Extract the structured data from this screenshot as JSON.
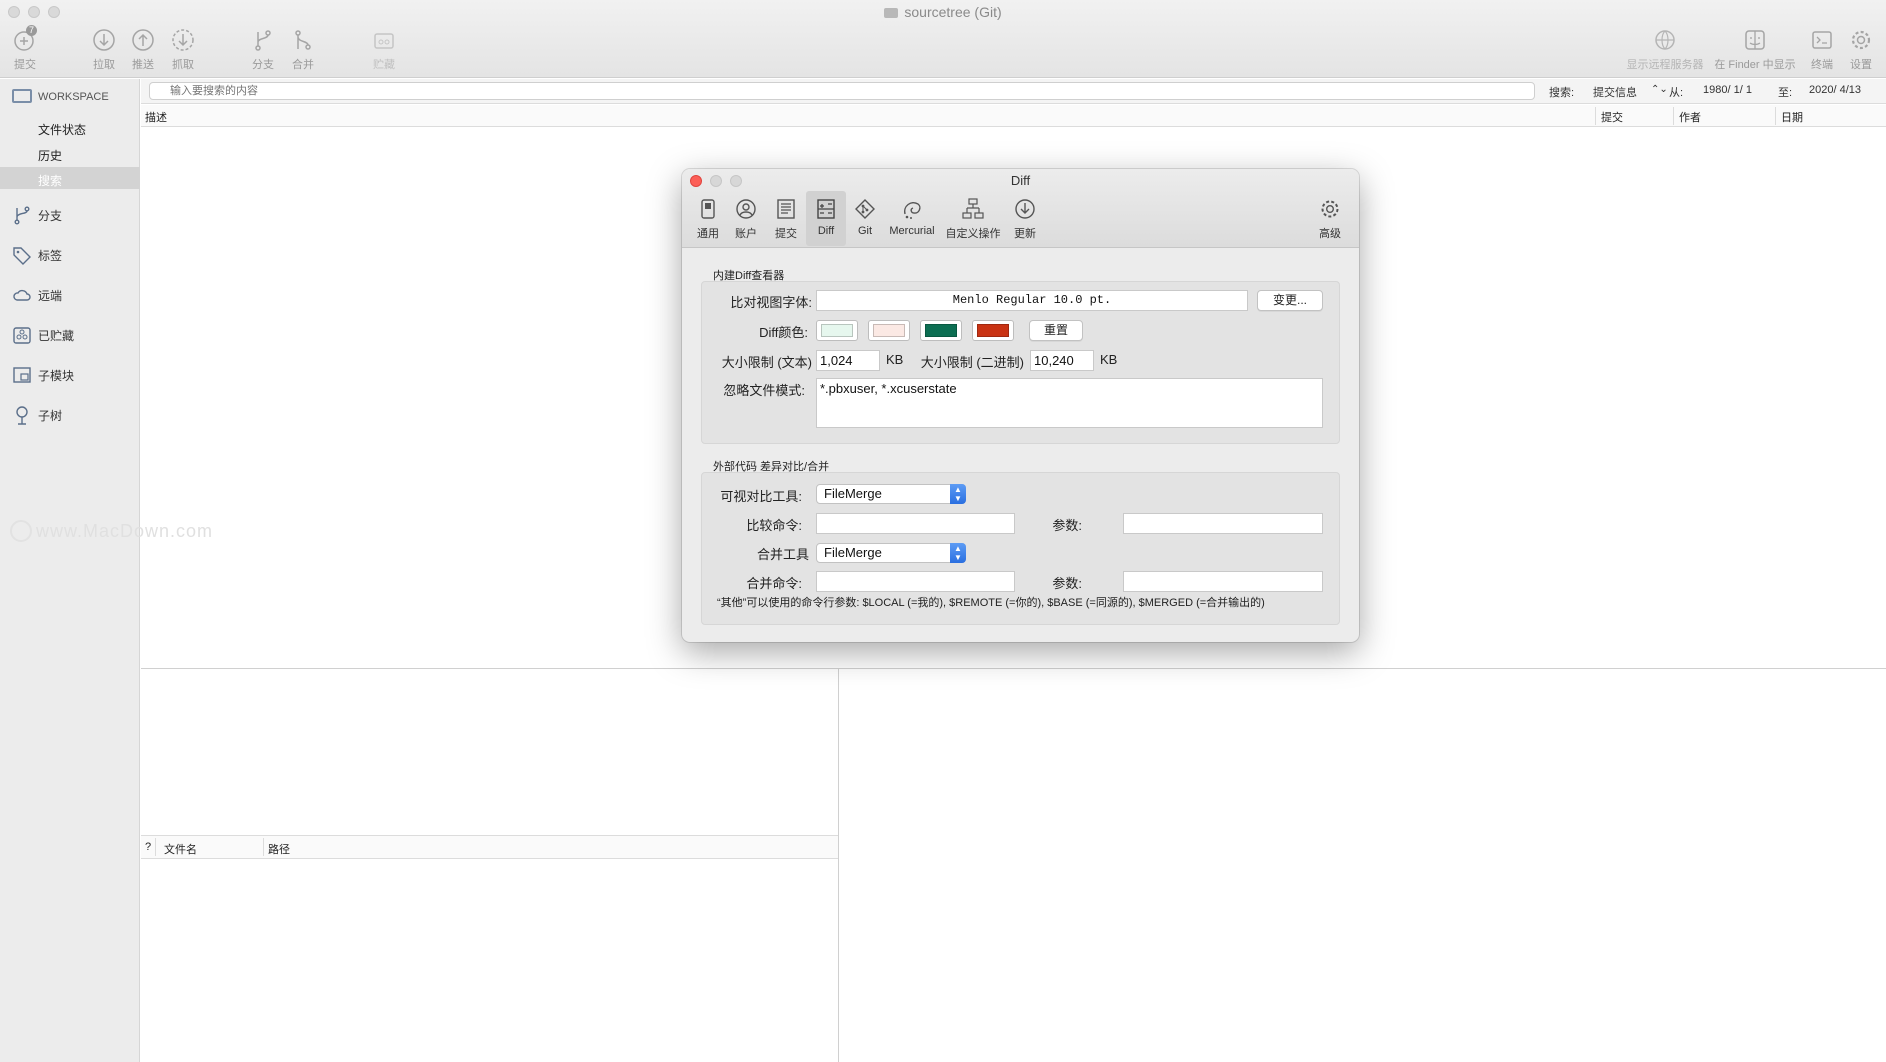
{
  "window": {
    "title": "sourcetree (Git)"
  },
  "toolbar": {
    "commit": "提交",
    "commit_badge": "7",
    "pull": "拉取",
    "push": "推送",
    "fetch": "抓取",
    "branch": "分支",
    "merge": "合并",
    "stash": "贮藏",
    "remote": "显示远程服务器",
    "finder": "在 Finder 中显示",
    "terminal": "终端",
    "settings": "设置"
  },
  "sidebar": {
    "workspace": "WORKSPACE",
    "file_status": "文件状态",
    "history": "历史",
    "search": "搜索",
    "items": [
      {
        "label": "分支",
        "icon": "branch-icon"
      },
      {
        "label": "标签",
        "icon": "tag-icon"
      },
      {
        "label": "远端",
        "icon": "cloud-icon"
      },
      {
        "label": "已贮藏",
        "icon": "stash-icon"
      },
      {
        "label": "子模块",
        "icon": "submodule-icon"
      },
      {
        "label": "子树",
        "icon": "subtree-icon"
      }
    ]
  },
  "search": {
    "placeholder": "输入要搜索的内容",
    "search_label": "搜索:",
    "search_type": "提交信息",
    "from_label": "从:",
    "from_date": "1980/ 1/ 1",
    "to_label": "至:",
    "to_date": "2020/ 4/13"
  },
  "columns": {
    "description": "描述",
    "commit": "提交",
    "author": "作者",
    "date": "日期"
  },
  "files": {
    "status": "?",
    "filename": "文件名",
    "path": "路径"
  },
  "watermark": "www.MacDown.com",
  "dialog": {
    "title": "Diff",
    "tabs": {
      "general": "通用",
      "accounts": "账户",
      "commit": "提交",
      "diff": "Diff",
      "git": "Git",
      "mercurial": "Mercurial",
      "custom": "自定义操作",
      "update": "更新",
      "advanced": "高级"
    },
    "builtin": {
      "group_title": "内建Diff查看器",
      "font_label": "比对视图字体:",
      "font_value": "Menlo Regular 10.0 pt.",
      "change_button": "变更...",
      "color_label": "Diff颜色:",
      "colors": [
        "#e6f7ee",
        "#fbe9e4",
        "#0c6e52",
        "#c93314"
      ],
      "reset_button": "重置",
      "size_text_label": "大小限制 (文本)",
      "size_text_value": "1,024",
      "size_text_unit": "KB",
      "size_bin_label": "大小限制 (二进制)",
      "size_bin_value": "10,240",
      "size_bin_unit": "KB",
      "ignore_label": "忽略文件模式:",
      "ignore_value": "*.pbxuser, *.xcuserstate"
    },
    "external": {
      "group_title": "外部代码 差异对比/合并",
      "visual_tool_label": "可视对比工具:",
      "visual_tool_value": "FileMerge",
      "diff_cmd_label": "比较命令:",
      "args_label": "参数:",
      "merge_tool_label": "合并工具",
      "merge_tool_value": "FileMerge",
      "merge_cmd_label": "合并命令:",
      "args2_label": "参数:",
      "note": "“其他”可以使用的命令行参数: $LOCAL (=我的), $REMOTE (=你的), $BASE (=同源的), $MERGED (=合并输出的)"
    }
  }
}
